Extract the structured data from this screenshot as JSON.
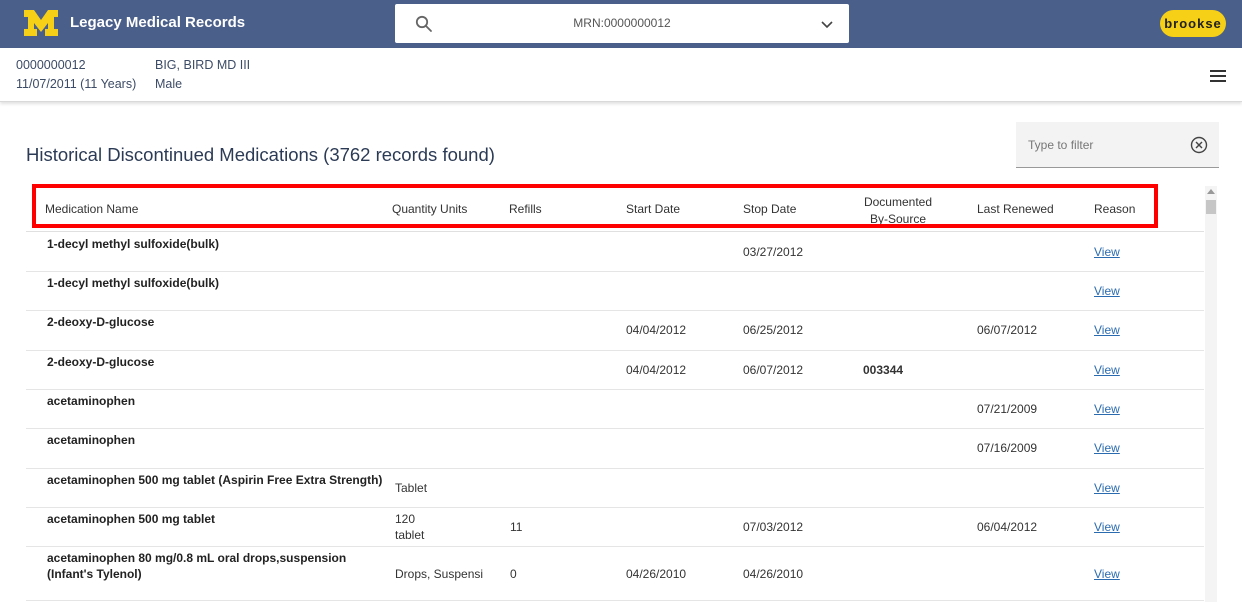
{
  "header": {
    "app_title": "Legacy Medical Records",
    "search_value": "MRN:0000000012",
    "user": "brookse",
    "brand_color": "#4a5f8a",
    "accent_color": "#f6cf17"
  },
  "patient": {
    "mrn": "0000000012",
    "dob": "11/07/2011 (11 Years)",
    "name": "BIG, BIRD MD III",
    "sex": "Male"
  },
  "page": {
    "title": "Historical Discontinued Medications (3762 records found)",
    "filter_placeholder": "Type to filter"
  },
  "table": {
    "columns": {
      "medication_name": "Medication Name",
      "quantity_units": "Quantity Units",
      "refills": "Refills",
      "start_date": "Start Date",
      "stop_date": "Stop Date",
      "documented_1": "Documented",
      "documented_2": "By-Source",
      "last_renewed": "Last Renewed",
      "reason": "Reason"
    },
    "rows": [
      {
        "name": "1-decyl methyl sulfoxide(bulk)",
        "name2": "",
        "qty": "",
        "qty2": "",
        "refills": "",
        "start": "",
        "stop": "03/27/2012",
        "doc": "",
        "renewed": "",
        "reason": "View"
      },
      {
        "name": "1-decyl methyl sulfoxide(bulk)",
        "name2": "",
        "qty": "",
        "qty2": "",
        "refills": "",
        "start": "",
        "stop": "",
        "doc": "",
        "renewed": "",
        "reason": "View"
      },
      {
        "name": "2-deoxy-D-glucose",
        "name2": "",
        "qty": "",
        "qty2": "",
        "refills": "",
        "start": "04/04/2012",
        "stop": "06/25/2012",
        "doc": "",
        "renewed": "06/07/2012",
        "reason": "View"
      },
      {
        "name": "2-deoxy-D-glucose",
        "name2": "",
        "qty": "",
        "qty2": "",
        "refills": "",
        "start": "04/04/2012",
        "stop": "06/07/2012",
        "doc": "003344",
        "renewed": "",
        "reason": "View"
      },
      {
        "name": "acetaminophen",
        "name2": "",
        "qty": "",
        "qty2": "",
        "refills": "",
        "start": "",
        "stop": "",
        "doc": "",
        "renewed": "07/21/2009",
        "reason": "View"
      },
      {
        "name": "acetaminophen",
        "name2": "",
        "qty": "",
        "qty2": "",
        "refills": "",
        "start": "",
        "stop": "",
        "doc": "",
        "renewed": "07/16/2009",
        "reason": "View"
      },
      {
        "name": "acetaminophen 500 mg tablet (Aspirin Free Extra Strength)",
        "name2": "",
        "qty": "Tablet",
        "qty2": "",
        "refills": "",
        "start": "",
        "stop": "",
        "doc": "",
        "renewed": "",
        "reason": "View"
      },
      {
        "name": "acetaminophen 500 mg tablet",
        "name2": "",
        "qty": "120",
        "qty2": "tablet",
        "refills": "11",
        "start": "",
        "stop": "07/03/2012",
        "doc": "",
        "renewed": "06/04/2012",
        "reason": "View"
      },
      {
        "name": "acetaminophen 80 mg/0.8 mL oral drops,suspension",
        "name2": "(Infant's Tylenol)",
        "qty": "Drops, Suspensi",
        "qty2": "",
        "refills": "0",
        "start": "04/26/2010",
        "stop": "04/26/2010",
        "doc": "",
        "renewed": "",
        "reason": "View"
      }
    ]
  }
}
